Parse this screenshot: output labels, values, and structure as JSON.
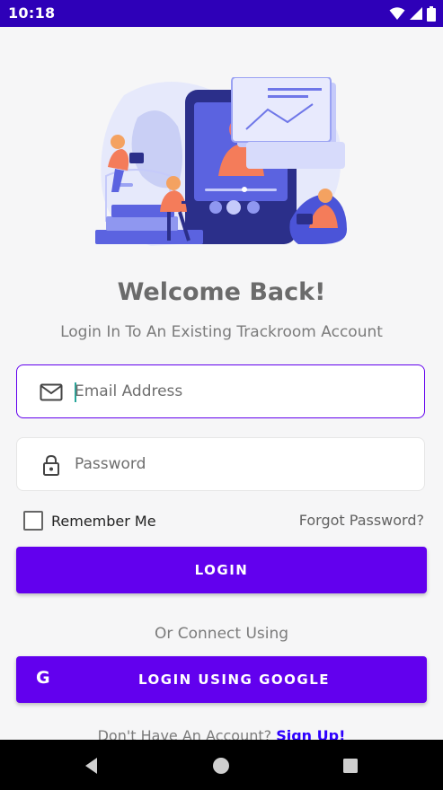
{
  "status_bar": {
    "time": "10:18",
    "icons": [
      "wifi-icon",
      "signal-icon",
      "battery-icon"
    ]
  },
  "illustration": {
    "icon": "online-learning-illustration"
  },
  "header": {
    "title": "Welcome Back!",
    "subtitle": "Login In To An Existing Trackroom Account"
  },
  "form": {
    "email": {
      "placeholder": "Email Address",
      "value": "",
      "icon": "mail-icon"
    },
    "password": {
      "placeholder": "Password",
      "value": "",
      "icon": "lock-icon"
    },
    "remember_me": {
      "label": "Remember Me",
      "checked": false
    },
    "forgot_password": "Forgot Password?",
    "login_button": "LOGIN"
  },
  "alt_login": {
    "or_text": "Or Connect Using",
    "google_icon": "G",
    "google_button": "LOGIN USING GOOGLE"
  },
  "signup": {
    "prompt": "Don't Have An Account?",
    "link": "Sign Up!"
  },
  "nav_bar": {
    "icons": [
      "back-icon",
      "home-icon",
      "recents-icon"
    ]
  },
  "colors": {
    "primary": "#6200ee",
    "status_bar": "#2e00b8",
    "link": "#2e00ff"
  }
}
